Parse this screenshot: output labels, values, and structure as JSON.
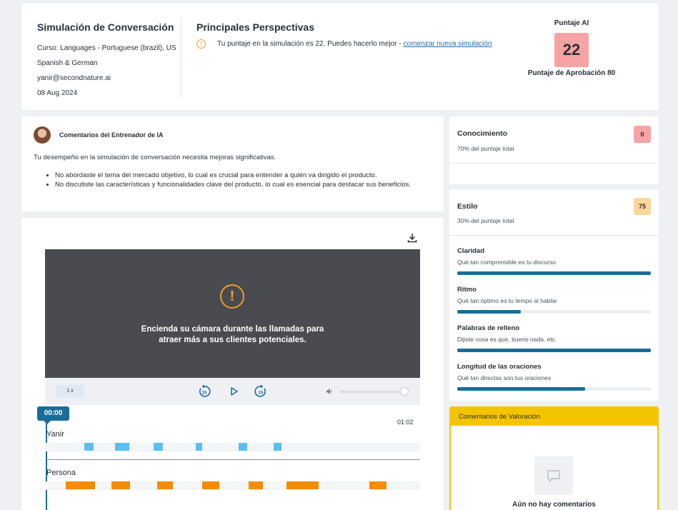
{
  "simulation": {
    "title": "Simulación de Conversación",
    "course": "Curso: Languages - Portuguese (brazil), US",
    "course_cont": "Spanish & German",
    "email": "yanir@secondnature.ai",
    "date": "08 Aug 2024"
  },
  "insights": {
    "title": "Principales Perspectivas",
    "text": "Tu puntaje en la simulación es 22. Puedes hacerlo mejor -",
    "link": "comenzar nueva simulación"
  },
  "ai_score": {
    "label": "Puntaje AI",
    "value": "22",
    "pass_label": "Puntaje de Aprobación 80",
    "box_color": "#f8a3a3"
  },
  "coach": {
    "title": "Comentarios del Entrenador de IA",
    "summary": "Tu desempeño en la simulación de conversación necesita mejoras significativas.",
    "points": [
      "No abordaste el tema del mercado objetivo, lo cual es crucial para entender a quién va dirigido el producto.",
      "No discutiste las características y funcionalidades clave del producto, lo cual es esencial para destacar sus beneficios."
    ]
  },
  "video": {
    "alert_icon": "!",
    "message": "Encienda su cámara durante las llamadas para atraer más a sus clientes potenciales.",
    "speed": "1 x",
    "current_time": "00:00",
    "end_time": "01:02",
    "volume": 0.95
  },
  "timeline": {
    "duration_seconds": 62,
    "tracks": [
      {
        "name": "Yanir",
        "color": "#5bbfef",
        "segments": [
          [
            5.0,
            6.6
          ],
          [
            10.2,
            12.7
          ],
          [
            16.8,
            18.3
          ],
          [
            23.9,
            25.1
          ],
          [
            31.3,
            32.7
          ],
          [
            37.2,
            38.5
          ]
        ]
      },
      {
        "name": "Persona",
        "color": "#f28c00",
        "segments": [
          [
            1.8,
            6.8
          ],
          [
            9.6,
            12.8
          ],
          [
            17.4,
            20.0
          ],
          [
            25.1,
            28.0
          ],
          [
            32.9,
            35.4
          ],
          [
            39.4,
            44.8
          ],
          [
            53.5,
            56.4
          ]
        ]
      }
    ]
  },
  "scores": {
    "knowledge": {
      "name": "Conocimiento",
      "weight": "70% del puntaje total",
      "value": "0",
      "color": "#f8a3a3"
    },
    "style": {
      "name": "Estilo",
      "weight": "30% del puntaje total",
      "value": "75",
      "color": "#fcd79a",
      "metrics": [
        {
          "name": "Claridad",
          "desc": "Qué tan comprensible es tu discurso",
          "fraction": 1.0
        },
        {
          "name": "Ritmo",
          "desc": "Qué tan óptimo es tu tempo al hablar",
          "fraction": 0.33
        },
        {
          "name": "Palabras de relleno",
          "desc": "Dijiste cosa es que, bueno nada, etc.",
          "fraction": 1.0
        },
        {
          "name": "Longitud de las oraciones",
          "desc": "Qué tan directas son tus oraciones",
          "fraction": 0.66
        }
      ]
    }
  },
  "feedback": {
    "title": "Comentarios de Valoración",
    "empty_text": "Aún no hay comentarios"
  }
}
